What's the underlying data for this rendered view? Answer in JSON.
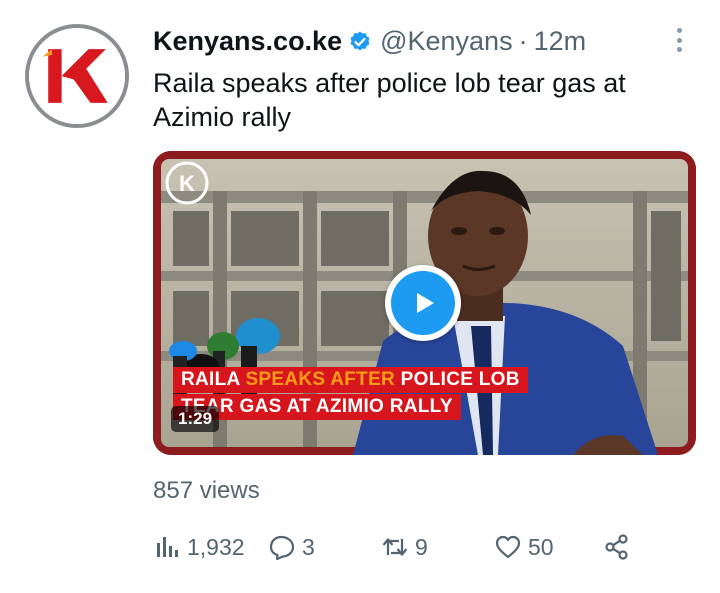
{
  "tweet": {
    "display_name": "Kenyans.co.ke",
    "handle": "@Kenyans",
    "separator": "·",
    "time": "12m",
    "text": "Raila speaks after police lob tear gas at Azimio rally",
    "verified": true
  },
  "media": {
    "caption_line1_parts": [
      "RAILA ",
      "SPEAKS AFTER",
      " POLICE LOB"
    ],
    "caption_line2": "TEAR GAS AT AZIMIO RALLY",
    "duration": "1:29",
    "logo_letter": "K"
  },
  "stats": {
    "views": "857 views",
    "analytics_count": "1,932",
    "reply_count": "3",
    "retweet_count": "9",
    "like_count": "50"
  },
  "icons": [
    "more-icon",
    "verified-icon",
    "play-icon",
    "analytics-icon",
    "reply-icon",
    "retweet-icon",
    "like-icon",
    "share-icon"
  ],
  "colors": {
    "accent": "#1d9bf0",
    "caption_red": "#d6161c",
    "caption_highlight": "#ff9c1a",
    "secondary_text": "#536471"
  }
}
